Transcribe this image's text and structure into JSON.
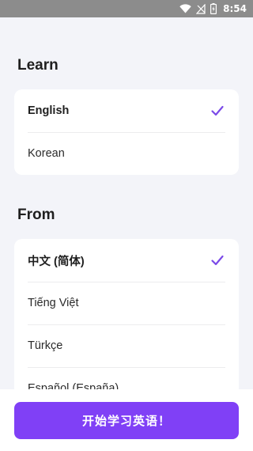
{
  "status_bar": {
    "time": "8:54",
    "icons": [
      "wifi-icon",
      "signal-off-icon",
      "battery-charging-icon"
    ]
  },
  "learn": {
    "title": "Learn",
    "options": [
      {
        "label": "English",
        "selected": true
      },
      {
        "label": "Korean",
        "selected": false
      }
    ]
  },
  "from": {
    "title": "From",
    "options": [
      {
        "label": "中文 (简体)",
        "selected": true
      },
      {
        "label": "Tiếng Việt",
        "selected": false
      },
      {
        "label": "Türkçe",
        "selected": false
      },
      {
        "label": "Español (España)",
        "selected": false
      }
    ]
  },
  "start_button": {
    "label": "开始学习英语！"
  },
  "colors": {
    "accent": "#8040f6",
    "check": "#7b4ae8",
    "background": "#f3f4f9"
  }
}
